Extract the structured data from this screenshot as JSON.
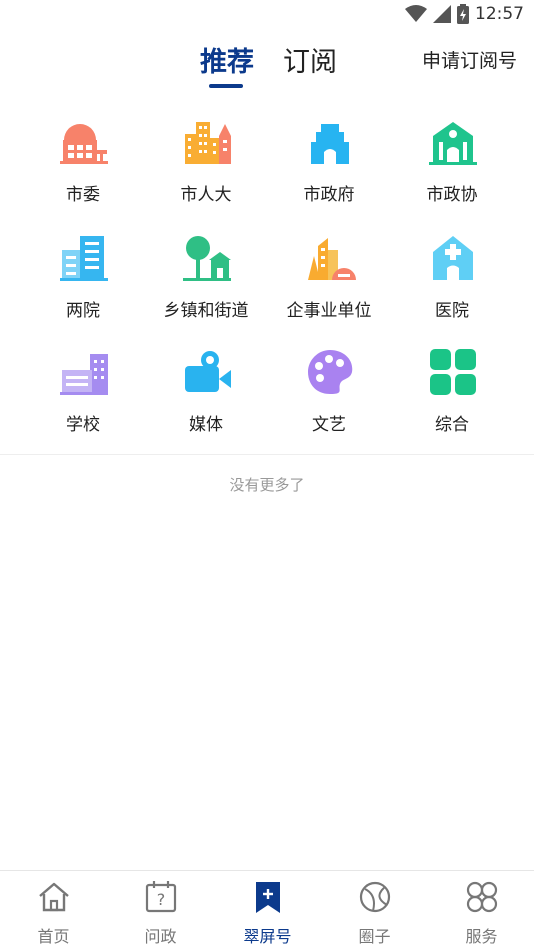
{
  "status_bar": {
    "time": "12:57"
  },
  "header": {
    "tabs": [
      {
        "label": "推荐",
        "active": true
      },
      {
        "label": "订阅",
        "active": false
      }
    ],
    "apply_label": "申请订阅号"
  },
  "categories": [
    {
      "label": "市委",
      "icon": "govt-building-icon",
      "color": "#f7826a"
    },
    {
      "label": "市人大",
      "icon": "city-buildings-icon",
      "color": "#f9ad33"
    },
    {
      "label": "市政府",
      "icon": "tower-building-icon",
      "color": "#27b4f1"
    },
    {
      "label": "市政协",
      "icon": "hall-building-icon",
      "color": "#1fc48d"
    },
    {
      "label": "两院",
      "icon": "court-buildings-icon",
      "color": "#36b6f0"
    },
    {
      "label": "乡镇和街道",
      "icon": "township-icon",
      "color": "#2fbf85"
    },
    {
      "label": "企事业单位",
      "icon": "enterprise-icon",
      "color": "#f9ab30"
    },
    {
      "label": "医院",
      "icon": "hospital-icon",
      "color": "#5fcff5"
    },
    {
      "label": "学校",
      "icon": "school-icon",
      "color": "#a58cf0"
    },
    {
      "label": "媒体",
      "icon": "video-camera-icon",
      "color": "#29b3ef"
    },
    {
      "label": "文艺",
      "icon": "palette-icon",
      "color": "#a982f0"
    },
    {
      "label": "综合",
      "icon": "grid-tiles-icon",
      "color": "#1bc487"
    }
  ],
  "footer_note": "没有更多了",
  "bottom_nav": [
    {
      "label": "首页",
      "icon": "home-icon",
      "active": false
    },
    {
      "label": "问政",
      "icon": "question-calendar-icon",
      "active": false
    },
    {
      "label": "翠屏号",
      "icon": "bookmark-plus-icon",
      "active": true
    },
    {
      "label": "圈子",
      "icon": "circle-globe-icon",
      "active": false
    },
    {
      "label": "服务",
      "icon": "clover-icon",
      "active": false
    }
  ],
  "colors": {
    "accent": "#0c3a8c",
    "muted": "#999999"
  }
}
